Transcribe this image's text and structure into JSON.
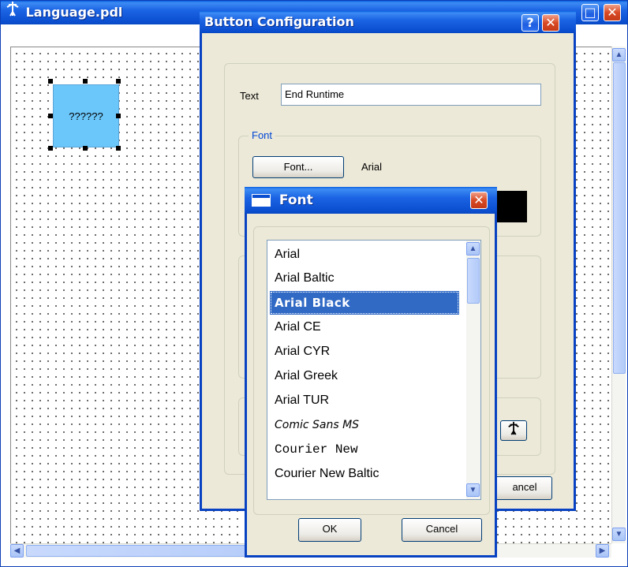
{
  "main_window": {
    "title": "Language.pdl",
    "canvas_button_text": "??????",
    "caption_buttons": [
      "□",
      "✕"
    ]
  },
  "config_dialog": {
    "title": "Button Configuration",
    "help_glyph": "?",
    "close_glyph": "✕",
    "text_label": "Text",
    "text_value": "End Runtime",
    "font_group_label": "Font",
    "font_button": "Font...",
    "font_name": "Arial",
    "cancel_partial": "ancel"
  },
  "font_dialog": {
    "title": "Font",
    "close_glyph": "✕",
    "fonts": [
      "Arial",
      "Arial Baltic",
      "Arial Black",
      "Arial CE",
      "Arial CYR",
      "Arial Greek",
      "Arial TUR",
      "Comic Sans MS",
      "Courier New",
      "Courier New Baltic"
    ],
    "selected_index": 2,
    "ok_label": "OK",
    "cancel_label": "Cancel"
  },
  "colors": {
    "titlebar": "#0a4ecf",
    "selection": "#316ac5",
    "button_fill": "#6bc6fa",
    "legend_text": "#0046d5"
  }
}
